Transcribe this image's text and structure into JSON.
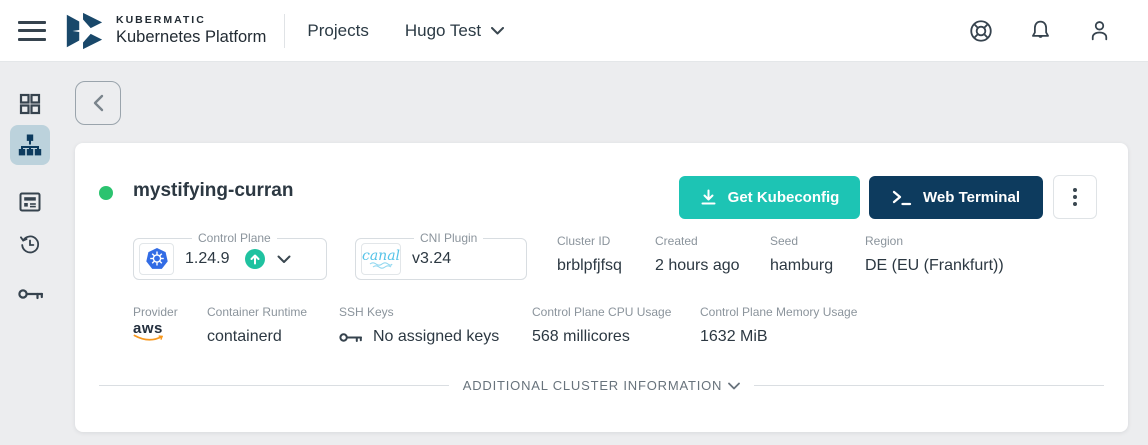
{
  "header": {
    "brand": {
      "line1": "KUBERMATIC",
      "line2": "Kubernetes Platform"
    },
    "nav": {
      "projects": "Projects"
    },
    "project_selector": {
      "value": "Hugo Test"
    }
  },
  "sidebar": {
    "items": [
      {
        "id": "dashboard",
        "icon": "grid-icon",
        "active": false
      },
      {
        "id": "clusters",
        "icon": "cluster-tree-icon",
        "active": true
      },
      {
        "id": "news",
        "icon": "form-icon",
        "active": false
      },
      {
        "id": "history",
        "icon": "history-icon",
        "active": false
      },
      {
        "id": "ssh-keys",
        "icon": "key-icon",
        "active": false
      }
    ]
  },
  "cluster": {
    "status": "healthy",
    "name": "mystifying-curran",
    "actions": {
      "kubeconfig": "Get Kubeconfig",
      "web_terminal": "Web Terminal"
    },
    "control_plane": {
      "label": "Control Plane",
      "version": "1.24.9",
      "upgrade_available": true
    },
    "cni_plugin": {
      "label": "CNI Plugin",
      "version": "v3.24",
      "logo_text": "canal"
    },
    "details": {
      "cluster_id": {
        "label": "Cluster ID",
        "value": "brblpfjfsq"
      },
      "created": {
        "label": "Created",
        "value": "2 hours ago"
      },
      "seed": {
        "label": "Seed",
        "value": "hamburg"
      },
      "region": {
        "label": "Region",
        "value": "DE (EU (Frankfurt))"
      },
      "provider": {
        "label": "Provider",
        "value": "aws"
      },
      "container_runtime": {
        "label": "Container Runtime",
        "value": "containerd"
      },
      "ssh_keys": {
        "label": "SSH Keys",
        "value": "No assigned keys"
      },
      "cpu_usage": {
        "label": "Control Plane CPU Usage",
        "value": "568 millicores"
      },
      "memory_usage": {
        "label": "Control Plane Memory Usage",
        "value": "1632 MiB"
      }
    },
    "additional_info_label": "ADDITIONAL CLUSTER INFORMATION"
  },
  "colors": {
    "accent_teal": "#1DC4B4",
    "navy": "#0D3B5E",
    "status_green": "#2BC36F",
    "upgrade_green": "#1FC2A0",
    "kubernetes_blue": "#326CE5",
    "canal_blue": "#56C3E8",
    "aws_orange": "#F7981F",
    "active_sidebar_bg": "#BCD2DC",
    "logo_blue": "#19486A"
  },
  "icons": {
    "menu-icon": "three horizontal bars",
    "kubermatic-logo": "blue cube K mark",
    "chevron-down-icon": "v",
    "help-icon": "lifebuoy ring",
    "bell-icon": "notification bell",
    "user-icon": "person silhouette",
    "grid-icon": "four squares",
    "cluster-tree-icon": "sitemap hierarchy",
    "form-icon": "document with fields",
    "history-icon": "clock with back arrow",
    "key-icon": "horizontal key",
    "back-chevron-icon": "<",
    "download-icon": "arrow down to line",
    "terminal-icon": ">_",
    "kebab-menu-icon": "vertical three dots",
    "kubernetes-icon": "blue heptagon helm wheel",
    "upgrade-arrow-icon": "white up arrow in green circle",
    "status-dot": "green circle"
  }
}
